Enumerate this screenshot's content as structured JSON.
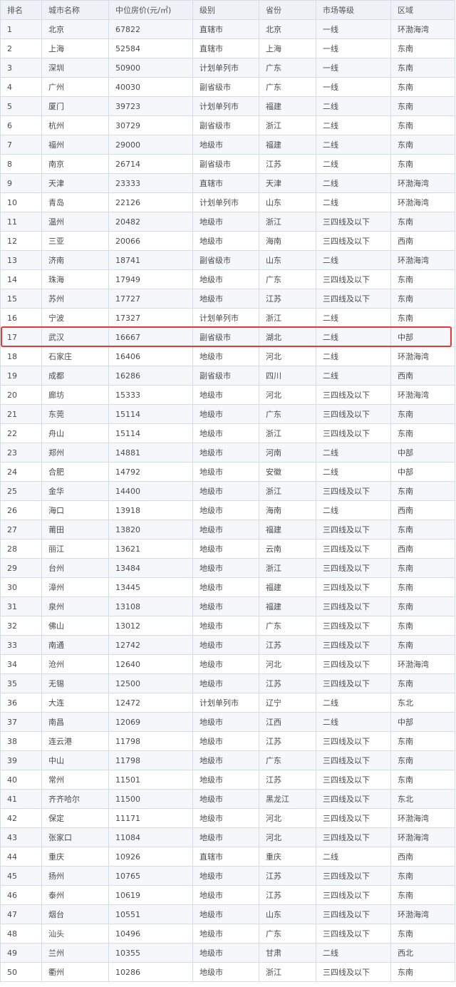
{
  "table": {
    "headers": [
      "排名",
      "城市名称",
      "中位房价(元/㎡)",
      "级别",
      "省份",
      "市场等级",
      "区域"
    ],
    "rows": [
      [
        "1",
        "北京",
        "67822",
        "直辖市",
        "北京",
        "一线",
        "环渤海湾"
      ],
      [
        "2",
        "上海",
        "52584",
        "直辖市",
        "上海",
        "一线",
        "东南"
      ],
      [
        "3",
        "深圳",
        "50900",
        "计划单列市",
        "广东",
        "一线",
        "东南"
      ],
      [
        "4",
        "广州",
        "40030",
        "副省级市",
        "广东",
        "一线",
        "东南"
      ],
      [
        "5",
        "厦门",
        "39723",
        "计划单列市",
        "福建",
        "二线",
        "东南"
      ],
      [
        "6",
        "杭州",
        "30729",
        "副省级市",
        "浙江",
        "二线",
        "东南"
      ],
      [
        "7",
        "福州",
        "29000",
        "地级市",
        "福建",
        "二线",
        "东南"
      ],
      [
        "8",
        "南京",
        "26714",
        "副省级市",
        "江苏",
        "二线",
        "东南"
      ],
      [
        "9",
        "天津",
        "23333",
        "直辖市",
        "天津",
        "二线",
        "环渤海湾"
      ],
      [
        "10",
        "青岛",
        "22126",
        "计划单列市",
        "山东",
        "二线",
        "环渤海湾"
      ],
      [
        "11",
        "温州",
        "20482",
        "地级市",
        "浙江",
        "三四线及以下",
        "东南"
      ],
      [
        "12",
        "三亚",
        "20066",
        "地级市",
        "海南",
        "三四线及以下",
        "西南"
      ],
      [
        "13",
        "济南",
        "18741",
        "副省级市",
        "山东",
        "二线",
        "环渤海湾"
      ],
      [
        "14",
        "珠海",
        "17949",
        "地级市",
        "广东",
        "三四线及以下",
        "东南"
      ],
      [
        "15",
        "苏州",
        "17727",
        "地级市",
        "江苏",
        "三四线及以下",
        "东南"
      ],
      [
        "16",
        "宁波",
        "17327",
        "计划单列市",
        "浙江",
        "二线",
        "东南"
      ],
      [
        "17",
        "武汉",
        "16667",
        "副省级市",
        "湖北",
        "二线",
        "中部"
      ],
      [
        "18",
        "石家庄",
        "16406",
        "地级市",
        "河北",
        "二线",
        "环渤海湾"
      ],
      [
        "19",
        "成都",
        "16286",
        "副省级市",
        "四川",
        "二线",
        "西南"
      ],
      [
        "20",
        "廊坊",
        "15333",
        "地级市",
        "河北",
        "三四线及以下",
        "环渤海湾"
      ],
      [
        "21",
        "东莞",
        "15114",
        "地级市",
        "广东",
        "三四线及以下",
        "东南"
      ],
      [
        "22",
        "舟山",
        "15114",
        "地级市",
        "浙江",
        "三四线及以下",
        "东南"
      ],
      [
        "23",
        "郑州",
        "14881",
        "地级市",
        "河南",
        "二线",
        "中部"
      ],
      [
        "24",
        "合肥",
        "14792",
        "地级市",
        "安徽",
        "二线",
        "中部"
      ],
      [
        "25",
        "金华",
        "14400",
        "地级市",
        "浙江",
        "三四线及以下",
        "东南"
      ],
      [
        "26",
        "海口",
        "13918",
        "地级市",
        "海南",
        "二线",
        "西南"
      ],
      [
        "27",
        "莆田",
        "13820",
        "地级市",
        "福建",
        "三四线及以下",
        "东南"
      ],
      [
        "28",
        "丽江",
        "13621",
        "地级市",
        "云南",
        "三四线及以下",
        "西南"
      ],
      [
        "29",
        "台州",
        "13484",
        "地级市",
        "浙江",
        "三四线及以下",
        "东南"
      ],
      [
        "30",
        "漳州",
        "13445",
        "地级市",
        "福建",
        "三四线及以下",
        "东南"
      ],
      [
        "31",
        "泉州",
        "13108",
        "地级市",
        "福建",
        "三四线及以下",
        "东南"
      ],
      [
        "32",
        "佛山",
        "13012",
        "地级市",
        "广东",
        "三四线及以下",
        "东南"
      ],
      [
        "33",
        "南通",
        "12742",
        "地级市",
        "江苏",
        "三四线及以下",
        "东南"
      ],
      [
        "34",
        "沧州",
        "12640",
        "地级市",
        "河北",
        "三四线及以下",
        "环渤海湾"
      ],
      [
        "35",
        "无锡",
        "12500",
        "地级市",
        "江苏",
        "三四线及以下",
        "东南"
      ],
      [
        "36",
        "大连",
        "12472",
        "计划单列市",
        "辽宁",
        "二线",
        "东北"
      ],
      [
        "37",
        "南昌",
        "12069",
        "地级市",
        "江西",
        "二线",
        "中部"
      ],
      [
        "38",
        "连云港",
        "11798",
        "地级市",
        "江苏",
        "三四线及以下",
        "东南"
      ],
      [
        "39",
        "中山",
        "11798",
        "地级市",
        "广东",
        "三四线及以下",
        "东南"
      ],
      [
        "40",
        "常州",
        "11501",
        "地级市",
        "江苏",
        "三四线及以下",
        "东南"
      ],
      [
        "41",
        "齐齐哈尔",
        "11500",
        "地级市",
        "黑龙江",
        "三四线及以下",
        "东北"
      ],
      [
        "42",
        "保定",
        "11171",
        "地级市",
        "河北",
        "三四线及以下",
        "环渤海湾"
      ],
      [
        "43",
        "张家口",
        "11084",
        "地级市",
        "河北",
        "三四线及以下",
        "环渤海湾"
      ],
      [
        "44",
        "重庆",
        "10926",
        "直辖市",
        "重庆",
        "二线",
        "西南"
      ],
      [
        "45",
        "扬州",
        "10765",
        "地级市",
        "江苏",
        "三四线及以下",
        "东南"
      ],
      [
        "46",
        "泰州",
        "10619",
        "地级市",
        "江苏",
        "三四线及以下",
        "东南"
      ],
      [
        "47",
        "烟台",
        "10551",
        "地级市",
        "山东",
        "三四线及以下",
        "环渤海湾"
      ],
      [
        "48",
        "汕头",
        "10496",
        "地级市",
        "广东",
        "三四线及以下",
        "东南"
      ],
      [
        "49",
        "兰州",
        "10355",
        "地级市",
        "甘肃",
        "二线",
        "西北"
      ],
      [
        "50",
        "衢州",
        "10286",
        "地级市",
        "浙江",
        "三四线及以下",
        "东南"
      ]
    ],
    "highlighted_rank": "17",
    "highlight_color": "#e53935"
  }
}
